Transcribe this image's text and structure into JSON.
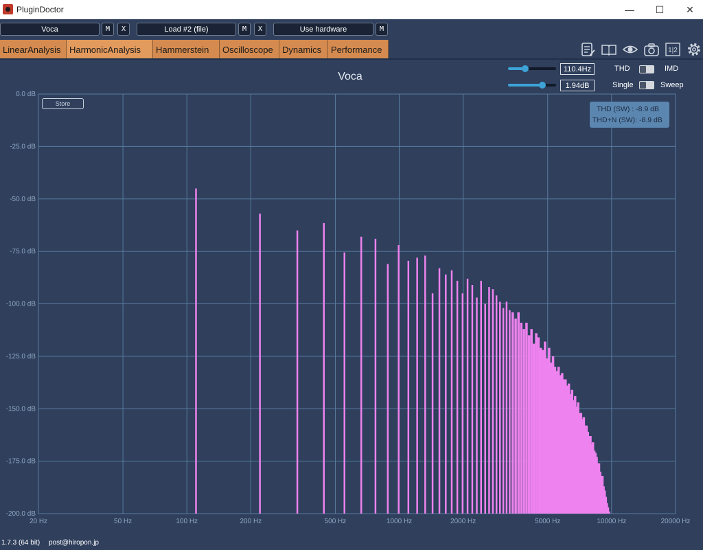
{
  "window": {
    "title": "PluginDoctor",
    "minimize_glyph": "—",
    "maximize_glyph": "☐",
    "close_glyph": "✕"
  },
  "slots": [
    {
      "name": "Voca",
      "m_label": "M",
      "x_label": "X"
    },
    {
      "name": "Load #2 (file)",
      "m_label": "M",
      "x_label": "X"
    },
    {
      "name": "Use hardware",
      "m_label": "M"
    }
  ],
  "tabs": [
    "LinearAnalysis",
    "HarmonicAnalysis",
    "Hammerstein",
    "Oscilloscope",
    "Dynamics",
    "Performance"
  ],
  "active_tab": "HarmonicAnalysis",
  "toolbar_icons": [
    "notes-icon",
    "book-icon",
    "eye-icon",
    "camera-icon",
    "split-view-icon",
    "settings-icon"
  ],
  "split_view_label": "1|2",
  "analysis": {
    "title": "Voca",
    "frequency": {
      "value": "110.4Hz",
      "fraction": 0.35
    },
    "level": {
      "value": "1.94dB",
      "fraction": 0.72
    },
    "mode_left": "THD",
    "mode_right": "IMD",
    "sweep_left": "Single",
    "sweep_right": "Sweep",
    "store_label": "Store",
    "readouts": [
      "THD (SW) : -8.9 dB",
      "THD+N (SW): -8.9 dB"
    ]
  },
  "colors": {
    "background": "#2f3f5c",
    "grid": "#5a7ea0",
    "bars": "#ee82ee",
    "tab": "#d58b4f",
    "readout_box": "#5b86b0"
  },
  "chart_data": {
    "type": "bar",
    "xscale": "log",
    "xlim": [
      20,
      20000
    ],
    "ylim": [
      -200,
      0
    ],
    "x_ticks": [
      "20 Hz",
      "50 Hz",
      "100 Hz",
      "200 Hz",
      "500 Hz",
      "1000 Hz",
      "2000 Hz",
      "5000 Hz",
      "10000 Hz",
      "20000 Hz"
    ],
    "x_tick_values": [
      20,
      50,
      100,
      200,
      500,
      1000,
      2000,
      5000,
      10000,
      20000
    ],
    "y_ticks": [
      "0.0 dB",
      "-25.0 dB",
      "-50.0 dB",
      "-75.0 dB",
      "-100.0 dB",
      "-125.0 dB",
      "-150.0 dB",
      "-175.0 dB",
      "-200.0 dB"
    ],
    "y_tick_values": [
      0,
      -25,
      -50,
      -75,
      -100,
      -125,
      -150,
      -175,
      -200
    ],
    "fundamental_hz": 110.4,
    "harmonics_db": [
      -45,
      -57,
      -65,
      -61.5,
      -75.5,
      -68,
      -69,
      -81,
      -72,
      -79.5,
      -78,
      -77,
      -95,
      -83,
      -86,
      -84,
      -89,
      -95,
      -88,
      -91,
      -97,
      -89,
      -100,
      -92,
      -93,
      -96,
      -99,
      -102,
      -99,
      -103,
      -104,
      -107,
      -104,
      -109,
      -112,
      -109,
      -115,
      -112,
      -119,
      -114,
      -116,
      -121,
      -122,
      -118,
      -126,
      -121,
      -128,
      -125,
      -130,
      -132,
      -130,
      -134,
      -133,
      -136,
      -136,
      -139,
      -138,
      -143,
      -141,
      -146,
      -144,
      -149,
      -147,
      -152,
      -152,
      -155,
      -154,
      -158,
      -158,
      -161,
      -163,
      -163,
      -167,
      -166,
      -170,
      -171,
      -173,
      -176,
      -176,
      -180,
      -182,
      -182,
      -187,
      -189,
      -192,
      -195,
      -197,
      -199,
      -200
    ]
  },
  "footer": {
    "version": "1.7.3 (64 bit)",
    "contact": "post@hiropon.jp"
  }
}
